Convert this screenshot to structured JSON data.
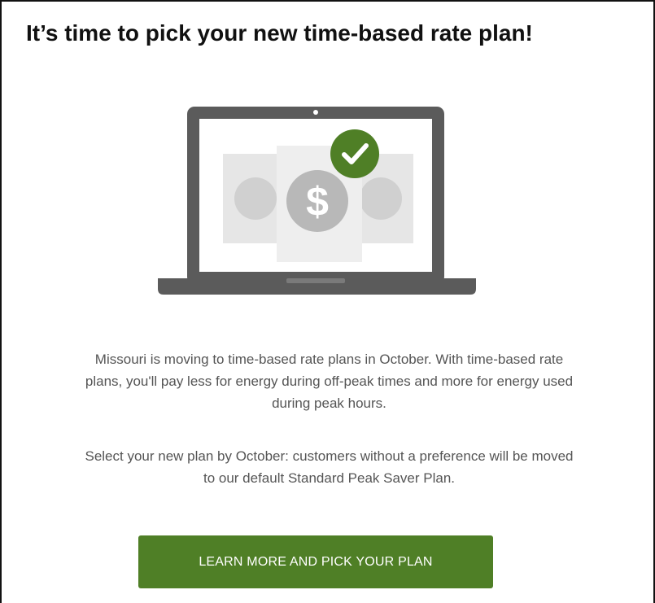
{
  "headline": "It’s time to pick your new time-based rate plan!",
  "illustration": {
    "dollar_symbol": "$",
    "check_symbol": "✓",
    "laptop_color": "#5b5b5b",
    "card_color": "#e3e3e3",
    "coin_color": "#b8b8b8",
    "check_badge_color": "#4f7f26"
  },
  "paragraph_1": [
    "Missouri is moving to time-based rate plans in October. With time-based rate",
    "plans, you'll pay less for energy during off-peak times and more for energy used",
    "during peak hours."
  ],
  "paragraph_2": [
    "Select your new plan by October: customers without a preference will be moved",
    "to our default Standard Peak Saver Plan."
  ],
  "cta": {
    "label": "LEARN MORE AND PICK YOUR PLAN",
    "color": "#4f7f26"
  }
}
